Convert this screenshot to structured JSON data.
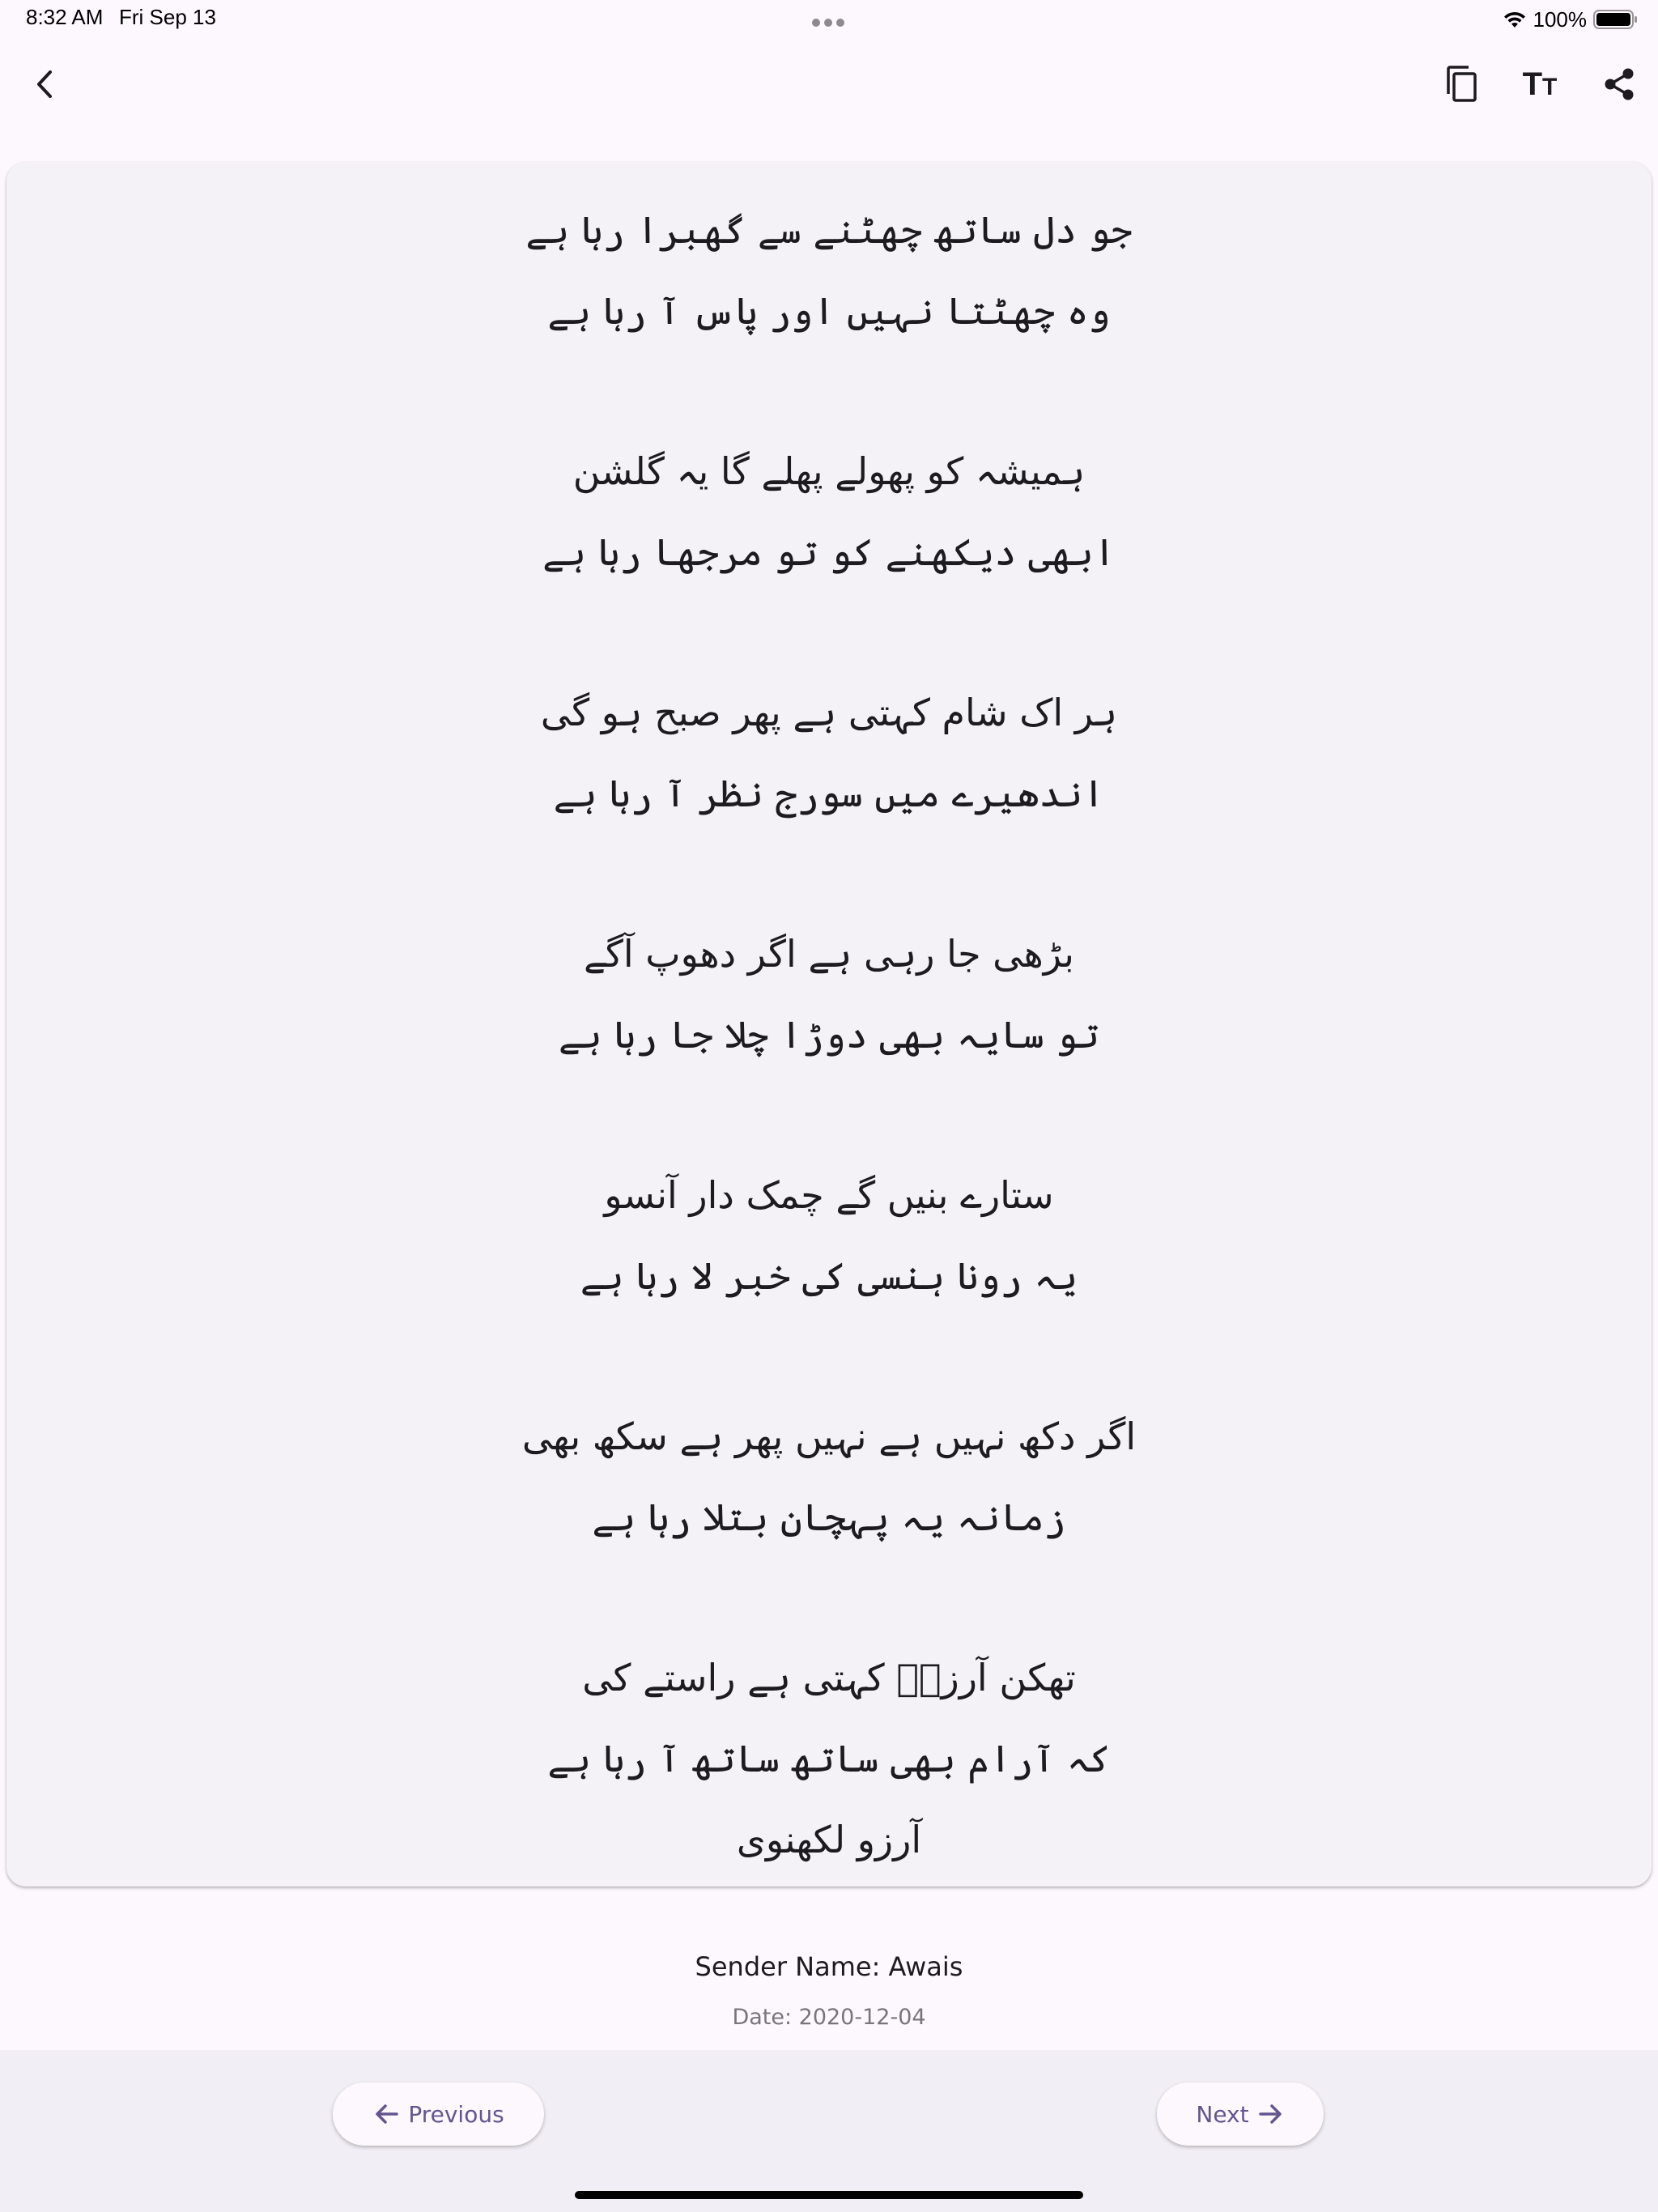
{
  "status_bar": {
    "time": "8:32 AM",
    "date": "Fri Sep 13",
    "battery": "100%"
  },
  "toolbar": {
    "back_icon": "chevron-left-icon",
    "copy_icon": "copy-icon",
    "text_size_icon": "text-size-icon",
    "share_icon": "share-icon"
  },
  "poem": {
    "stanzas": [
      [
        "جو دل ساتھ چھٹنے سے گھبرا رہا ہے",
        "وہ چھٹتا نہیں اور پاس آ رہا ہے"
      ],
      [
        "ہمیشہ کو پھولے پھلے گا یہ گلشن",
        "ابھی دیکھنے کو تو مرجھا رہا ہے"
      ],
      [
        "ہر اک شام کہتی ہے پھر صبح ہو گی",
        "اندھیرے میں سورج نظر آ رہا ہے"
      ],
      [
        "بڑھی جا رہی ہے اگر دھوپ آگے",
        "تو سایہ بھی دوڑا چلا جا رہا ہے"
      ],
      [
        "ستارے بنیں گے چمک دار آنسو",
        "یہ رونا ہنسی کی خبر لا رہا ہے"
      ],
      [
        "اگر دکھ نہیں ہے نہیں پھر ہے سکھ بھی",
        "زمانہ یہ پہچان بتلا رہا ہے"
      ],
      [
        "تھکن آرزوؔ کہتی ہے راستے کی",
        "کہ آرام بھی ساتھ ساتھ آ رہا ہے",
        "آرزو لکھنوی"
      ]
    ]
  },
  "meta": {
    "sender": "Sender Name: Awais",
    "date": "Date: 2020-12-04"
  },
  "navigation": {
    "previous_label": "Previous",
    "next_label": "Next"
  },
  "colors": {
    "accent": "#65558f",
    "background": "#fdf8fd",
    "card": "#f4f1f7"
  }
}
